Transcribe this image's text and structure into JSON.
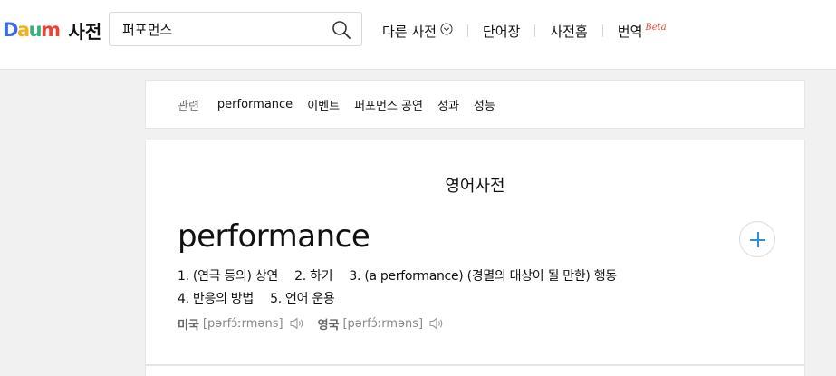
{
  "header": {
    "logo": {
      "letters": [
        {
          "ch": "D",
          "color": "#3b6be5"
        },
        {
          "ch": "a",
          "color": "#f2b019"
        },
        {
          "ch": "u",
          "color": "#2fb47c"
        },
        {
          "ch": "m",
          "color": "#ef4231"
        }
      ],
      "title": "사전"
    },
    "search": {
      "value": "퍼포먼스",
      "placeholder": ""
    },
    "nav": [
      {
        "label": "다른 사전"
      },
      {
        "label": "단어장"
      },
      {
        "label": "사전홈"
      },
      {
        "label": "번역",
        "badge": "Beta"
      }
    ]
  },
  "related": {
    "label": "관련",
    "keywords": [
      "performance",
      "이벤트",
      "퍼포먼스 공연",
      "성과",
      "성능"
    ]
  },
  "entry": {
    "section_title": "영어사전",
    "word": "performance",
    "meanings": [
      "1. (연극 등의) 상연",
      "2. 하기",
      "3. (a performance) (경멸의 대상이 될 만한) 행동",
      "4. 반응의 방법",
      "5. 언어 운용"
    ],
    "pronunciations": [
      {
        "locale": "미국",
        "ipa": "[pərfɔ́ːrməns]",
        "icon": "speaker-icon"
      },
      {
        "locale": "영국",
        "ipa": "[pərfɔ́ːrməns]",
        "icon": "speaker-icon"
      }
    ]
  },
  "colors": {
    "highlight": "#ffea00",
    "accent": "#2d8fdb",
    "beta": "#e9442e"
  }
}
